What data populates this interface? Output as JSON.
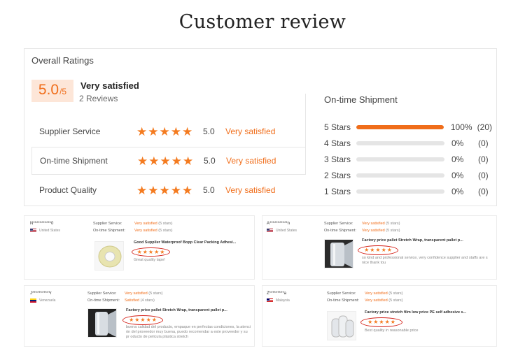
{
  "headline": "Customer review",
  "overall": {
    "title": "Overall Ratings",
    "score": "5.0",
    "score_denominator": "/5",
    "verdict": "Very satisfied",
    "review_count": "2 Reviews",
    "metrics": [
      {
        "label": "Supplier Service",
        "score": "5.0",
        "verdict": "Very satisfied",
        "stars": 5
      },
      {
        "label": "On-time Shipment",
        "score": "5.0",
        "verdict": "Very satisfied",
        "stars": 5
      },
      {
        "label": "Product Quality",
        "score": "5.0",
        "verdict": "Very satisfied",
        "stars": 5
      }
    ]
  },
  "shipment": {
    "title": "On-time Shipment",
    "rows": [
      {
        "label": "5 Stars",
        "percent": "100%",
        "count": "(20)",
        "fill": 1.0
      },
      {
        "label": "4 Stars",
        "percent": "0%",
        "count": "(0)",
        "fill": 0
      },
      {
        "label": "3 Stars",
        "percent": "0%",
        "count": "(0)",
        "fill": 0
      },
      {
        "label": "2 Stars",
        "percent": "0%",
        "count": "(0)",
        "fill": 0
      },
      {
        "label": "1 Stars",
        "percent": "0%",
        "count": "(0)",
        "fill": 0
      }
    ]
  },
  "colors": {
    "accent": "#f06d1a",
    "star": "#f47b20",
    "ring": "#d4231b"
  },
  "reviews": [
    {
      "reviewer": "N***********0",
      "country": "United States",
      "supplier_label": "Supplier Service:",
      "supplier_value": "Very satisfied",
      "supplier_stars": "(5 stars)",
      "shipment_label": "On-time Shipment:",
      "shipment_value": "Very satisfied",
      "shipment_stars": "(5 stars)",
      "product": "Good Supplier Waterproof Bopp Clear Packing Adhesi...",
      "rating": 5,
      "comment": "Great quality tape!"
    },
    {
      "reviewer": "A***********n",
      "country": "United States",
      "supplier_label": "Supplier Service:",
      "supplier_value": "Very satisfied",
      "supplier_stars": "(5 stars)",
      "shipment_label": "On-time Shipment:",
      "shipment_value": "Very satisfied",
      "shipment_stars": "(5 stars)",
      "product": "Factory price pallet Stretch Wrap, transparent pallet p...",
      "rating": 5,
      "comment": "so kind and professional service, very confidence supplier and staffs are s nice  thank tou"
    },
    {
      "reviewer": "J***********r",
      "country": "Venezuela",
      "supplier_label": "Supplier Service:",
      "supplier_value": "Very satisfied",
      "supplier_stars": "(5 stars)",
      "shipment_label": "On-time Shipment:",
      "shipment_value": "Satisfied",
      "shipment_stars": "(4 stars)",
      "product": "Factory price pallet Stretch Wrap, transparent pallet p...",
      "rating": 5,
      "comment": "buena calidad del producto, empaque en perfectas condiciones, la atenci ón del proveedor muy buena, puedo recomendar a este proveedor y su pr oducto de pelicula plástica stretch"
    },
    {
      "reviewer": "Z*********a",
      "country": "Malaysia",
      "supplier_label": "Supplier Service:",
      "supplier_value": "Very satisfied",
      "supplier_stars": "(5 stars)",
      "shipment_label": "On-time Shipment:",
      "shipment_value": "Very satisfied",
      "shipment_stars": "(5 stars)",
      "product": "Factory price stretch film low price PE self adhesive s...",
      "rating": 5,
      "comment": "Best quality in reasonable price"
    }
  ]
}
